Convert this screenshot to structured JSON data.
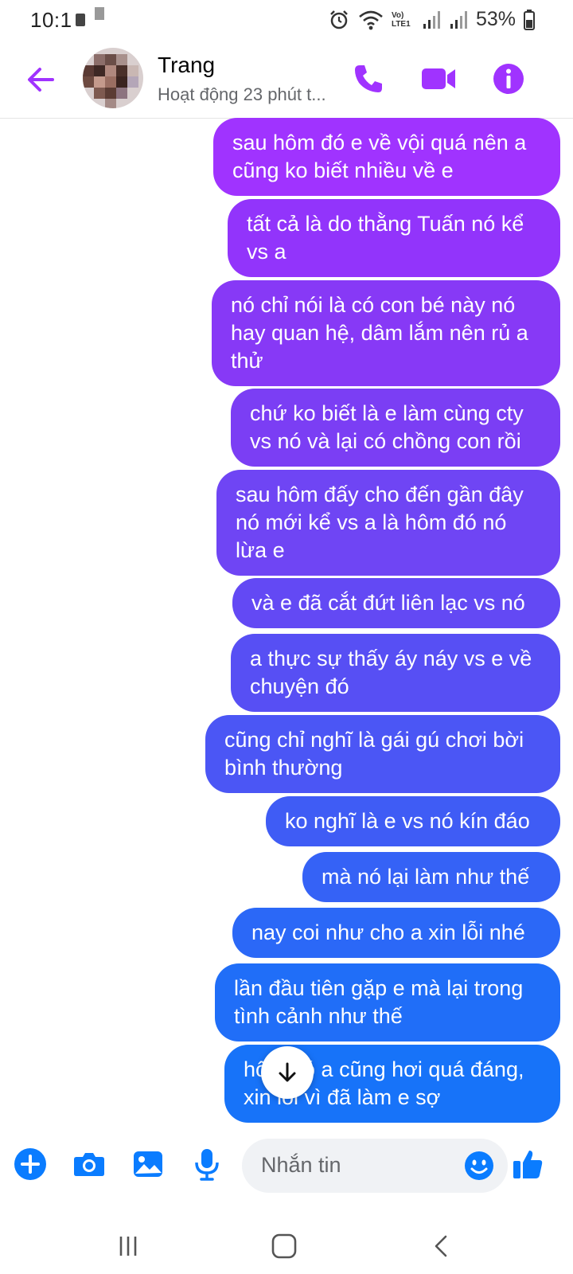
{
  "status_bar": {
    "time": "10:1",
    "battery_text": "53%",
    "icons": [
      "alarm-icon",
      "wifi-icon",
      "volte-icon",
      "signal-icon",
      "signal-icon",
      "battery-icon"
    ],
    "volte_label": "Vo) LTE1"
  },
  "header": {
    "contact_name": "Trang",
    "status": "Hoạt động 23 phút t...",
    "accent_color": "#a033ff"
  },
  "messages": [
    {
      "text": "sau hôm đó e về vội quá nên a cũng ko biết nhiều về e",
      "color": "#a033ff"
    },
    {
      "text": "tất cả là do thằng Tuấn nó kể vs a",
      "color": "#9234fb"
    },
    {
      "text": "nó chỉ nói là có con bé này nó hay quan hệ, dâm lắm nên rủ a thử",
      "color": "#8739f6"
    },
    {
      "text": "chứ ko biết là e làm cùng cty vs nó và lại có chồng con rồi",
      "color": "#7b3ef4"
    },
    {
      "text": "sau hôm đấy cho đến gần đây nó mới kể vs a là hôm đó nó lừa e",
      "color": "#6f45f4"
    },
    {
      "text": "và e đã cắt đứt liên lạc vs nó",
      "color": "#6349f4"
    },
    {
      "text": "a thực sự thấy áy náy vs e về chuyện đó",
      "color": "#574ff4"
    },
    {
      "text": "cũng chỉ nghĩ là gái gú chơi bời bình thường",
      "color": "#4b56f5"
    },
    {
      "text": "ko nghĩ là e vs nó kín đáo",
      "color": "#3f5cf5"
    },
    {
      "text": "mà nó lại làm như thế",
      "color": "#3562f6"
    },
    {
      "text": "nay coi như cho a xin lỗi nhé",
      "color": "#2b68f7"
    },
    {
      "text": "lần đầu tiên gặp e mà lại trong tình cảnh như thế",
      "color": "#206ef8"
    },
    {
      "text": "hôm đó a cũng hơi quá đáng, xin lỗi vì đã làm e sợ",
      "color": "#1773f9"
    }
  ],
  "composer": {
    "placeholder": "Nhắn tin",
    "icons": [
      "plus-icon",
      "camera-icon",
      "image-icon",
      "microphone-icon",
      "emoji-icon",
      "thumbs-up-icon"
    ],
    "icon_color": "#0084ff"
  },
  "nav": {
    "icons": [
      "recent-apps-icon",
      "home-icon",
      "back-icon"
    ]
  }
}
